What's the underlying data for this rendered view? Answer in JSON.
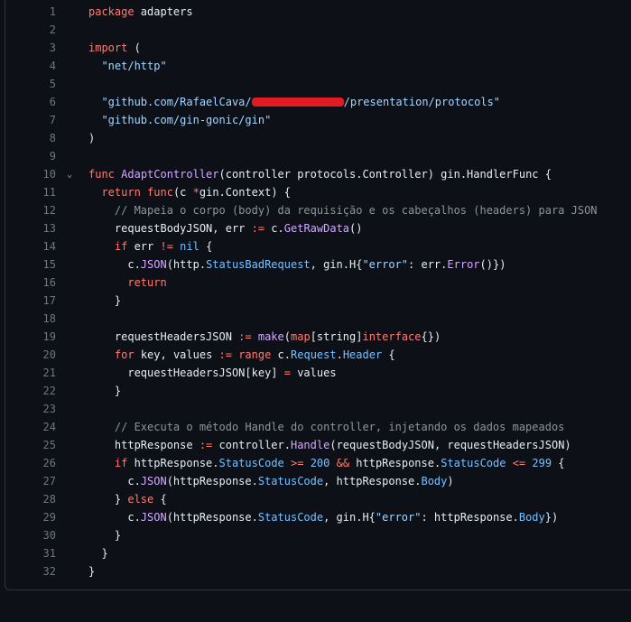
{
  "editor": {
    "language": "go",
    "lines": [
      {
        "n": "1",
        "tokens": [
          {
            "t": "package",
            "c": "kw"
          },
          {
            "t": " adapters"
          }
        ]
      },
      {
        "n": "2",
        "tokens": []
      },
      {
        "n": "3",
        "tokens": [
          {
            "t": "import",
            "c": "kw"
          },
          {
            "t": " ("
          }
        ]
      },
      {
        "n": "4",
        "tokens": [
          {
            "t": "  "
          },
          {
            "t": "\"net/http\"",
            "c": "str"
          }
        ]
      },
      {
        "n": "5",
        "tokens": []
      },
      {
        "n": "6",
        "tokens": [
          {
            "t": "  "
          },
          {
            "t": "\"github.com/RafaelCava/",
            "c": "str"
          },
          {
            "redact": true
          },
          {
            "t": "/presentation/protocols\"",
            "c": "str"
          }
        ]
      },
      {
        "n": "7",
        "tokens": [
          {
            "t": "  "
          },
          {
            "t": "\"github.com/gin-gonic/gin\"",
            "c": "str"
          }
        ]
      },
      {
        "n": "8",
        "tokens": [
          {
            "t": ")"
          }
        ]
      },
      {
        "n": "9",
        "tokens": []
      },
      {
        "n": "10",
        "fold": true,
        "tokens": [
          {
            "t": "func",
            "c": "kw"
          },
          {
            "t": " "
          },
          {
            "t": "AdaptController",
            "c": "fn"
          },
          {
            "t": "(controller protocols.Controller) gin.HandlerFunc {"
          }
        ]
      },
      {
        "n": "11",
        "tokens": [
          {
            "t": "  "
          },
          {
            "t": "return",
            "c": "kw"
          },
          {
            "t": " "
          },
          {
            "t": "func",
            "c": "kw"
          },
          {
            "t": "(c "
          },
          {
            "t": "*",
            "c": "kw"
          },
          {
            "t": "gin.Context) {"
          }
        ]
      },
      {
        "n": "12",
        "tokens": [
          {
            "t": "    "
          },
          {
            "t": "// Mapeia o corpo (body) da requisição e os cabeçalhos (headers) para JSON",
            "c": "cm"
          }
        ]
      },
      {
        "n": "13",
        "tokens": [
          {
            "t": "    requestBodyJSON, err "
          },
          {
            "t": ":=",
            "c": "kw"
          },
          {
            "t": " c."
          },
          {
            "t": "GetRawData",
            "c": "fn"
          },
          {
            "t": "()"
          }
        ]
      },
      {
        "n": "14",
        "tokens": [
          {
            "t": "    "
          },
          {
            "t": "if",
            "c": "kw"
          },
          {
            "t": " err "
          },
          {
            "t": "!=",
            "c": "kw"
          },
          {
            "t": " "
          },
          {
            "t": "nil",
            "c": "prop"
          },
          {
            "t": " {"
          }
        ]
      },
      {
        "n": "15",
        "tokens": [
          {
            "t": "      c."
          },
          {
            "t": "JSON",
            "c": "fn"
          },
          {
            "t": "(http."
          },
          {
            "t": "StatusBadRequest",
            "c": "prop"
          },
          {
            "t": ", gin.H{"
          },
          {
            "t": "\"error\"",
            "c": "str"
          },
          {
            "t": ": err."
          },
          {
            "t": "Error",
            "c": "fn"
          },
          {
            "t": "()})"
          }
        ]
      },
      {
        "n": "16",
        "tokens": [
          {
            "t": "      "
          },
          {
            "t": "return",
            "c": "kw"
          }
        ]
      },
      {
        "n": "17",
        "tokens": [
          {
            "t": "    }"
          }
        ]
      },
      {
        "n": "18",
        "tokens": []
      },
      {
        "n": "19",
        "tokens": [
          {
            "t": "    requestHeadersJSON "
          },
          {
            "t": ":=",
            "c": "kw"
          },
          {
            "t": " "
          },
          {
            "t": "make",
            "c": "fn"
          },
          {
            "t": "("
          },
          {
            "t": "map",
            "c": "kw"
          },
          {
            "t": "[string]"
          },
          {
            "t": "interface",
            "c": "kw"
          },
          {
            "t": "{})"
          }
        ]
      },
      {
        "n": "20",
        "tokens": [
          {
            "t": "    "
          },
          {
            "t": "for",
            "c": "kw"
          },
          {
            "t": " key, values "
          },
          {
            "t": ":=",
            "c": "kw"
          },
          {
            "t": " "
          },
          {
            "t": "range",
            "c": "kw"
          },
          {
            "t": " c."
          },
          {
            "t": "Request",
            "c": "prop"
          },
          {
            "t": "."
          },
          {
            "t": "Header",
            "c": "prop"
          },
          {
            "t": " {"
          }
        ]
      },
      {
        "n": "21",
        "tokens": [
          {
            "t": "      requestHeadersJSON[key] "
          },
          {
            "t": "=",
            "c": "kw"
          },
          {
            "t": " values"
          }
        ]
      },
      {
        "n": "22",
        "tokens": [
          {
            "t": "    }"
          }
        ]
      },
      {
        "n": "23",
        "tokens": []
      },
      {
        "n": "24",
        "tokens": [
          {
            "t": "    "
          },
          {
            "t": "// Executa o método Handle do controller, injetando os dados mapeados",
            "c": "cm"
          }
        ]
      },
      {
        "n": "25",
        "tokens": [
          {
            "t": "    httpResponse "
          },
          {
            "t": ":=",
            "c": "kw"
          },
          {
            "t": " controller."
          },
          {
            "t": "Handle",
            "c": "fn"
          },
          {
            "t": "(requestBodyJSON, requestHeadersJSON)"
          }
        ]
      },
      {
        "n": "26",
        "tokens": [
          {
            "t": "    "
          },
          {
            "t": "if",
            "c": "kw"
          },
          {
            "t": " httpResponse."
          },
          {
            "t": "StatusCode",
            "c": "prop"
          },
          {
            "t": " "
          },
          {
            "t": ">=",
            "c": "kw"
          },
          {
            "t": " "
          },
          {
            "t": "200",
            "c": "num"
          },
          {
            "t": " "
          },
          {
            "t": "&&",
            "c": "kw"
          },
          {
            "t": " httpResponse."
          },
          {
            "t": "StatusCode",
            "c": "prop"
          },
          {
            "t": " "
          },
          {
            "t": "<=",
            "c": "kw"
          },
          {
            "t": " "
          },
          {
            "t": "299",
            "c": "num"
          },
          {
            "t": " {"
          }
        ]
      },
      {
        "n": "27",
        "tokens": [
          {
            "t": "      c."
          },
          {
            "t": "JSON",
            "c": "fn"
          },
          {
            "t": "(httpResponse."
          },
          {
            "t": "StatusCode",
            "c": "prop"
          },
          {
            "t": ", httpResponse."
          },
          {
            "t": "Body",
            "c": "prop"
          },
          {
            "t": ")"
          }
        ]
      },
      {
        "n": "28",
        "tokens": [
          {
            "t": "    } "
          },
          {
            "t": "else",
            "c": "kw"
          },
          {
            "t": " {"
          }
        ]
      },
      {
        "n": "29",
        "tokens": [
          {
            "t": "      c."
          },
          {
            "t": "JSON",
            "c": "fn"
          },
          {
            "t": "(httpResponse."
          },
          {
            "t": "StatusCode",
            "c": "prop"
          },
          {
            "t": ", gin.H{"
          },
          {
            "t": "\"error\"",
            "c": "str"
          },
          {
            "t": ": httpResponse."
          },
          {
            "t": "Body",
            "c": "prop"
          },
          {
            "t": "})"
          }
        ]
      },
      {
        "n": "30",
        "tokens": [
          {
            "t": "    }"
          }
        ]
      },
      {
        "n": "31",
        "tokens": [
          {
            "t": "  }"
          }
        ]
      },
      {
        "n": "32",
        "tokens": [
          {
            "t": "}"
          }
        ]
      }
    ]
  }
}
